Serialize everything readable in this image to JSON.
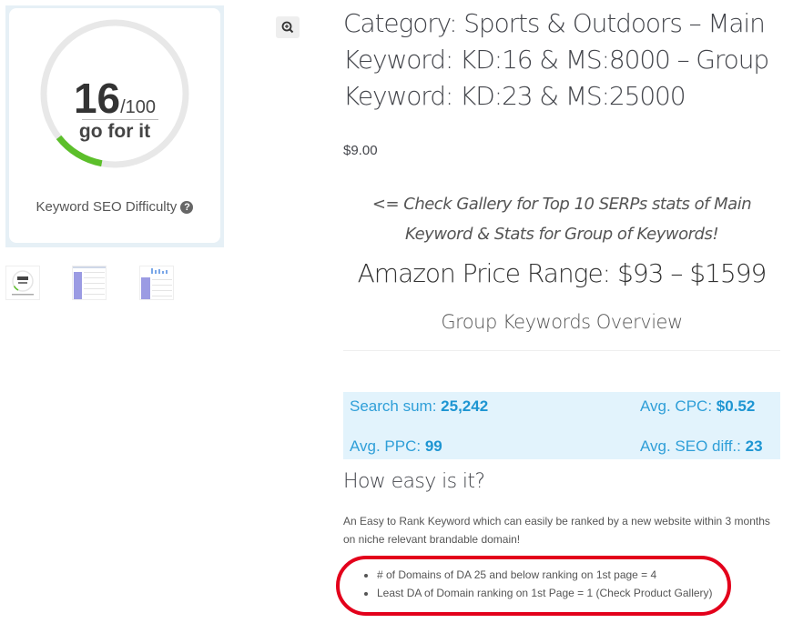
{
  "gallery": {
    "kd_score": "16",
    "kd_max": "/100",
    "kd_verdict": "go for it",
    "kd_caption": "Keyword SEO Difficulty",
    "kd_fraction": 0.16,
    "help_glyph": "?",
    "zoom_icon": "zoom-in-icon",
    "thumbnails": [
      "keyword-difficulty-gauge",
      "serp-stats-table",
      "group-keywords-table"
    ]
  },
  "product": {
    "title": "Category: Sports & Outdoors – Main Keyword: KD:16 & MS:8000 – Group Keyword: KD:23 & MS:25000",
    "price": "$9.00",
    "gallery_note": "<= Check Gallery for Top 10 SERPs stats of Main Keyword & Stats for Group of Keywords!",
    "amazon_range": "Amazon Price Range: $93 – $1599",
    "overview_heading": "Group Keywords Overview"
  },
  "stats": {
    "search_sum_label": "Search sum: ",
    "search_sum_value": "25,242",
    "avg_cpc_label": "Avg. CPC: ",
    "avg_cpc_value": "$0.52",
    "avg_ppc_label": "Avg. PPC: ",
    "avg_ppc_value": "99",
    "avg_seo_label": "Avg. SEO diff.: ",
    "avg_seo_value": "23"
  },
  "ease": {
    "heading": "How easy is it?",
    "description": "An Easy to Rank Keyword which can easily be ranked by a new website within 3 months on niche relevant brandable domain!",
    "bullets": [
      "# of Domains of DA 25 and below ranking on 1st page = 4",
      "Least DA of Domain ranking on 1st Page = 1 (Check Product Gallery)"
    ]
  },
  "colors": {
    "gauge_green": "#5cbf2a",
    "gauge_track": "#e8e8e8",
    "stats_bg": "#e2f3fc",
    "stats_text": "#2f9fd8",
    "highlight_red": "#e3001b"
  }
}
